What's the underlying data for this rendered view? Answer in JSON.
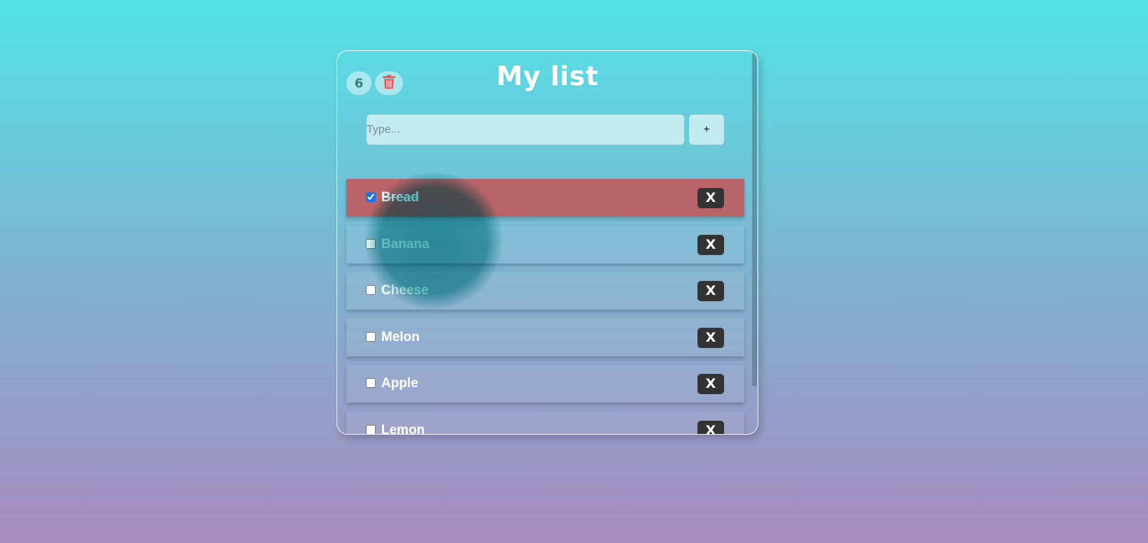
{
  "header": {
    "count": "6",
    "title": "My list",
    "trash_icon": "trash-icon"
  },
  "add_form": {
    "placeholder": "Type...",
    "value": "",
    "add_label": "+"
  },
  "items": [
    {
      "label": "Bread",
      "checked": true
    },
    {
      "label": "Banana",
      "checked": false
    },
    {
      "label": "Cheese",
      "checked": false
    },
    {
      "label": "Melon",
      "checked": false
    },
    {
      "label": "Apple",
      "checked": false
    },
    {
      "label": "Lemon",
      "checked": false
    }
  ],
  "delete_label": "X",
  "colors": {
    "done_item": "#b86469",
    "delete_button": "#333333",
    "trash_icon": "#ef5a5a",
    "count_text": "#3f7b78"
  }
}
